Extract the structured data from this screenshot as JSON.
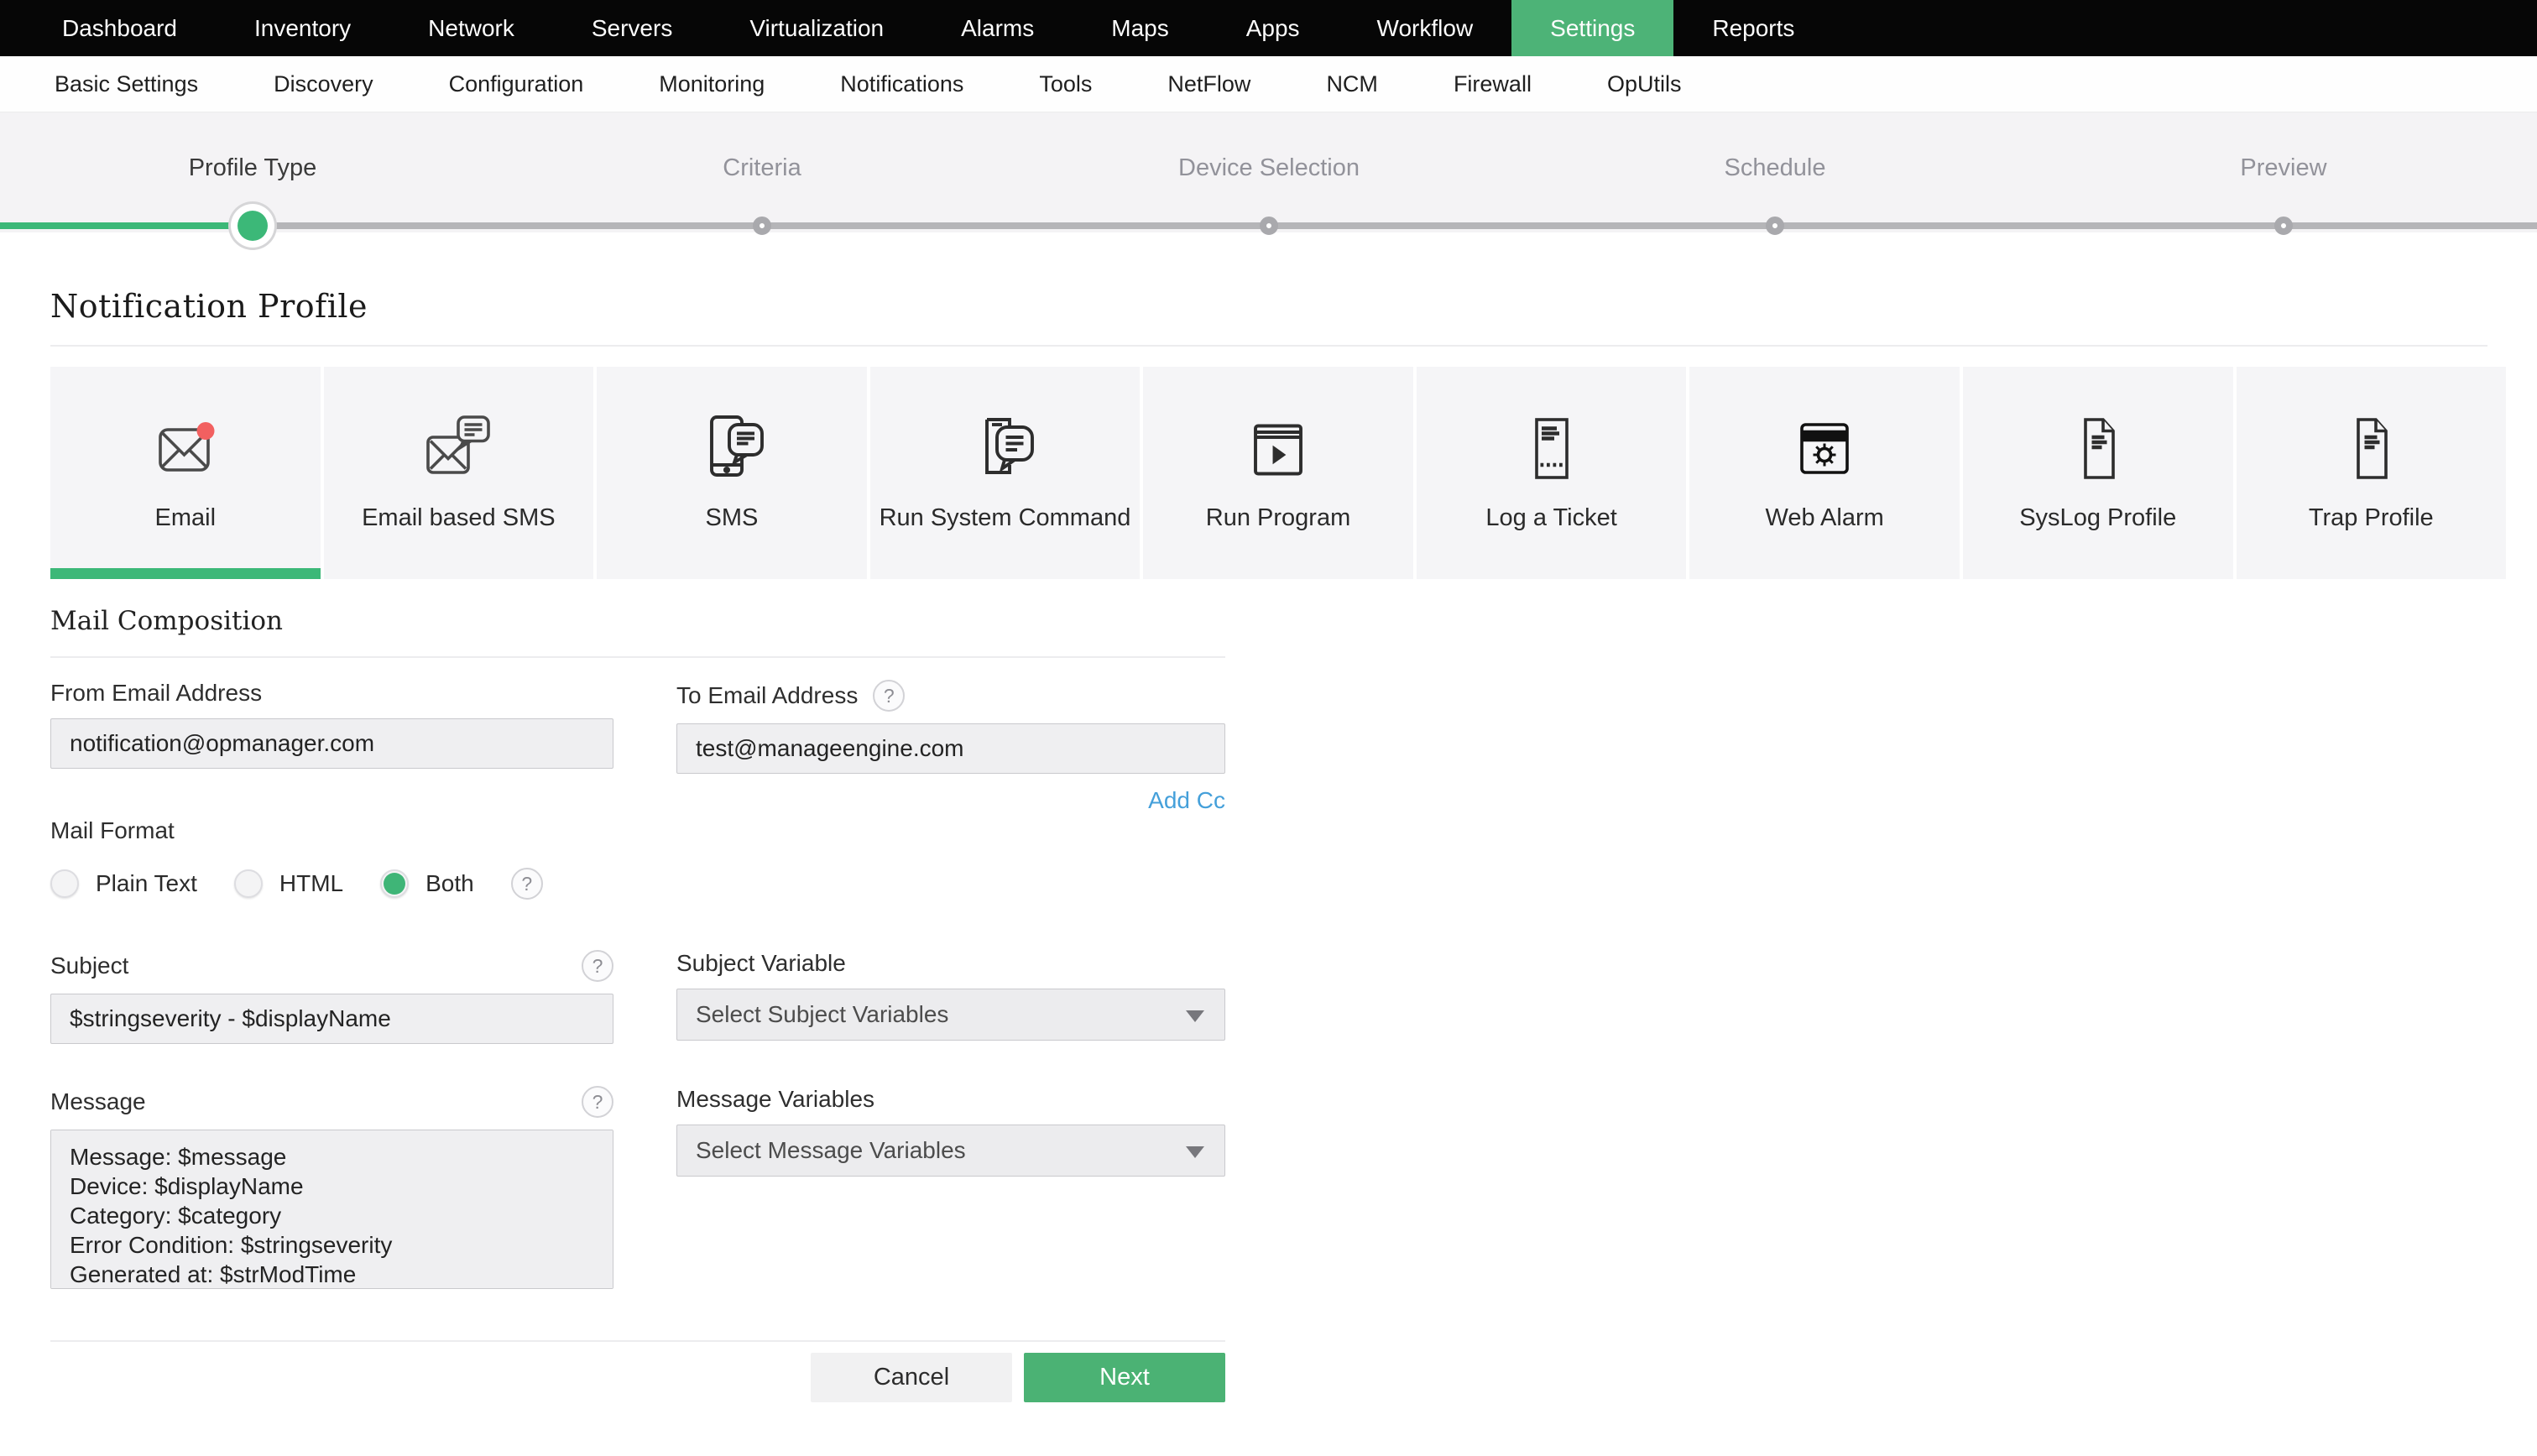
{
  "topnav": {
    "items": [
      {
        "label": "Dashboard"
      },
      {
        "label": "Inventory"
      },
      {
        "label": "Network"
      },
      {
        "label": "Servers"
      },
      {
        "label": "Virtualization"
      },
      {
        "label": "Alarms"
      },
      {
        "label": "Maps"
      },
      {
        "label": "Apps"
      },
      {
        "label": "Workflow"
      },
      {
        "label": "Settings"
      },
      {
        "label": "Reports"
      }
    ],
    "active": "Settings"
  },
  "subnav": {
    "items": [
      {
        "label": "Basic Settings"
      },
      {
        "label": "Discovery"
      },
      {
        "label": "Configuration"
      },
      {
        "label": "Monitoring"
      },
      {
        "label": "Notifications"
      },
      {
        "label": "Tools"
      },
      {
        "label": "NetFlow"
      },
      {
        "label": "NCM"
      },
      {
        "label": "Firewall"
      },
      {
        "label": "OpUtils"
      }
    ]
  },
  "stepper": {
    "steps": [
      {
        "label": "Profile Type",
        "state": "active"
      },
      {
        "label": "Criteria",
        "state": "upcoming"
      },
      {
        "label": "Device Selection",
        "state": "upcoming"
      },
      {
        "label": "Schedule",
        "state": "upcoming"
      },
      {
        "label": "Preview",
        "state": "upcoming"
      }
    ]
  },
  "page": {
    "title": "Notification Profile"
  },
  "profile_types": {
    "tiles": [
      {
        "label": "Email",
        "icon": "email-icon",
        "selected": true
      },
      {
        "label": "Email based SMS",
        "icon": "email-based-sms-icon",
        "selected": false
      },
      {
        "label": "SMS",
        "icon": "sms-icon",
        "selected": false
      },
      {
        "label": "Run System Command",
        "icon": "run-system-command-icon",
        "selected": false
      },
      {
        "label": "Run Program",
        "icon": "run-program-icon",
        "selected": false
      },
      {
        "label": "Log a Ticket",
        "icon": "log-a-ticket-icon",
        "selected": false
      },
      {
        "label": "Web Alarm",
        "icon": "web-alarm-icon",
        "selected": false
      },
      {
        "label": "SysLog Profile",
        "icon": "syslog-profile-icon",
        "selected": false
      },
      {
        "label": "Trap Profile",
        "icon": "trap-profile-icon",
        "selected": false
      }
    ]
  },
  "mail_composition": {
    "section_title": "Mail Composition",
    "from_email": {
      "label": "From Email Address",
      "value": "notification@opmanager.com"
    },
    "to_email": {
      "label": "To Email Address",
      "help": "?",
      "value": "test@manageengine.com"
    },
    "add_cc_label": "Add Cc",
    "mail_format": {
      "label": "Mail Format",
      "help": "?",
      "options": [
        {
          "label": "Plain Text",
          "selected": false
        },
        {
          "label": "HTML",
          "selected": false
        },
        {
          "label": "Both",
          "selected": true
        }
      ]
    },
    "subject": {
      "label": "Subject",
      "help": "?",
      "value": "$stringseverity - $displayName"
    },
    "subject_variable": {
      "label": "Subject Variable",
      "placeholder": "Select Subject Variables"
    },
    "message": {
      "label": "Message",
      "help": "?",
      "value": "Message: $message\nDevice: $displayName\nCategory: $category\nError Condition: $stringseverity\nGenerated at: $strModTime"
    },
    "message_variables": {
      "label": "Message Variables",
      "placeholder": "Select Message Variables"
    }
  },
  "buttons": {
    "cancel": "Cancel",
    "next": "Next"
  },
  "colors": {
    "accent_green": "#3cb878",
    "nav_active_green": "#4db377",
    "button_green": "#4bb274",
    "link_blue": "#45a0da",
    "nav_black": "#060606",
    "alert_red": "#f26060"
  }
}
